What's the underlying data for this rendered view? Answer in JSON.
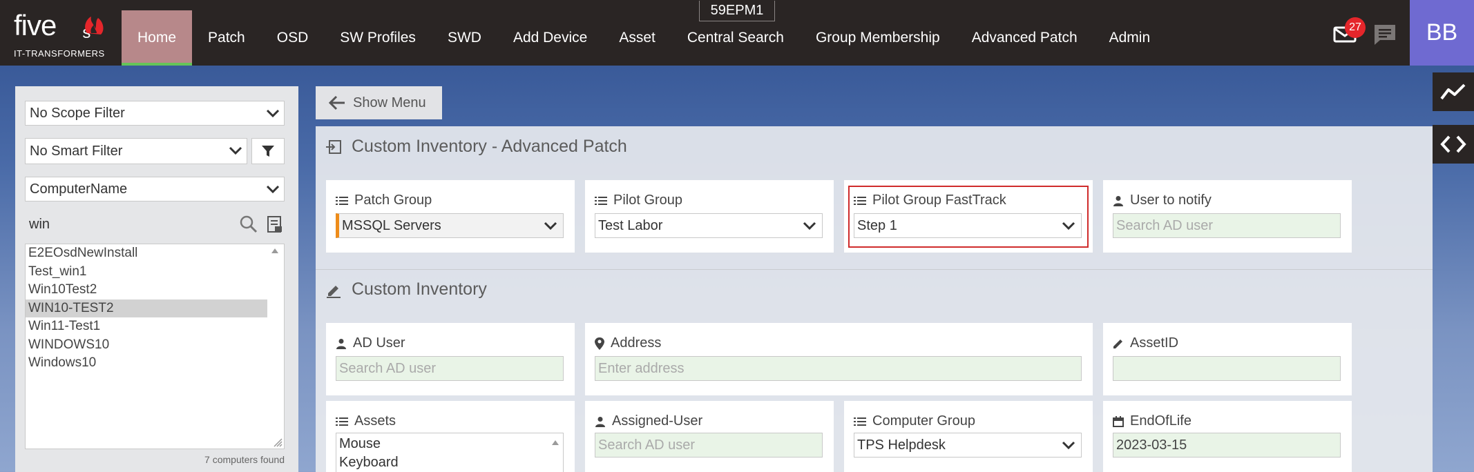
{
  "header": {
    "logo_word": "five",
    "logo_s": "s",
    "logo_sub": "IT-TRANSFORMERS",
    "hostname": "59EPM1",
    "nav": [
      {
        "label": "Home",
        "active": true
      },
      {
        "label": "Patch"
      },
      {
        "label": "OSD"
      },
      {
        "label": "SW Profiles"
      },
      {
        "label": "SWD"
      },
      {
        "label": "Add Device"
      },
      {
        "label": "Asset"
      },
      {
        "label": "Central Search"
      },
      {
        "label": "Group Membership"
      },
      {
        "label": "Advanced Patch"
      },
      {
        "label": "Admin"
      }
    ],
    "mail_badge": "27",
    "avatar_initials": "BB",
    "colors": {
      "bar": "#2a2524",
      "active_tab": "#b7888a",
      "active_underline": "#65c458",
      "avatar": "#6f6ad1",
      "badge": "#e5262b"
    }
  },
  "side_tools": {
    "analytics_icon": "trend-line-icon",
    "code_icon": "code-brackets-icon"
  },
  "left_panel": {
    "scope_filter": "No Scope Filter",
    "smart_filter": "No Smart Filter",
    "field_select": "ComputerName",
    "search_value": "win",
    "computers": [
      "E2EOsdNewInstall",
      "Test_win1",
      "Win10Test2",
      "WIN10-TEST2",
      "Win11-Test1",
      "WINDOWS10",
      "Windows10"
    ],
    "selected_index": 3,
    "found_text": "7 computers found"
  },
  "main": {
    "show_menu_label": "Show Menu",
    "advanced_patch": {
      "title": "Custom Inventory - Advanced Patch",
      "patch_group": {
        "label": "Patch Group",
        "value": "MSSQL Servers"
      },
      "pilot_group": {
        "label": "Pilot Group",
        "value": "Test Labor"
      },
      "pilot_fasttrack": {
        "label": "Pilot Group FastTrack",
        "value": "Step 1"
      },
      "user_notify": {
        "label": "User to notify",
        "placeholder": "Search AD user"
      }
    },
    "custom_inventory": {
      "title": "Custom Inventory",
      "ad_user": {
        "label": "AD User",
        "placeholder": "Search AD user"
      },
      "address": {
        "label": "Address",
        "placeholder": "Enter address"
      },
      "asset_id": {
        "label": "AssetID",
        "value": ""
      },
      "assets": {
        "label": "Assets",
        "items": [
          "Mouse",
          "Keyboard"
        ]
      },
      "assigned_user": {
        "label": "Assigned-User",
        "placeholder": "Search AD user"
      },
      "computer_group": {
        "label": "Computer Group",
        "value": "TPS Helpdesk"
      },
      "end_of_life": {
        "label": "EndOfLife",
        "value": "2023-03-15"
      }
    },
    "colors": {
      "highlight": "#cf2b2b",
      "field_green": "#e9f4e7",
      "patch_accent": "#ee8c1a"
    }
  }
}
